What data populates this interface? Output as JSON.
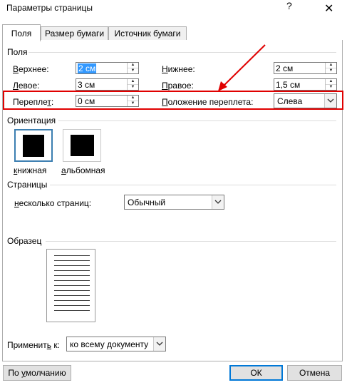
{
  "window": {
    "title": "Параметры страницы",
    "help_glyph": "?",
    "close_glyph": "✕"
  },
  "tabs": [
    {
      "label": "Поля",
      "active": true
    },
    {
      "label": "Размер бумаги",
      "active": false
    },
    {
      "label": "Источник бумаги",
      "active": false
    }
  ],
  "margins": {
    "group_label": "Поля",
    "top": {
      "label_u": "В",
      "label_rest": "ерхнее:",
      "value": "2 см"
    },
    "bottom": {
      "label_u": "Н",
      "label_rest": "ижнее:",
      "value": "2 см"
    },
    "left": {
      "label_u": "Л",
      "label_rest": "евое:",
      "value": "3 см"
    },
    "right": {
      "label_u": "П",
      "label_rest": "равое:",
      "value": "1,5 см"
    },
    "gutter": {
      "label_pre": "Перепле",
      "label_u": "т",
      "label_post": ":",
      "value": "0 см"
    },
    "gutter_pos": {
      "label_u": "П",
      "label_rest": "оложение переплета:",
      "value": "Слева"
    }
  },
  "orientation": {
    "group_label": "Ориентация",
    "portrait": {
      "label_u": "к",
      "label_rest": "нижная"
    },
    "landscape": {
      "label_u": "а",
      "label_rest": "льбомная"
    }
  },
  "pages": {
    "group_label": "Страницы",
    "multiple_label_u": "н",
    "multiple_label_rest": "есколько страниц:",
    "multiple_value": "Обычный"
  },
  "sample": {
    "group_label": "Образец"
  },
  "apply": {
    "label_pre": "Применит",
    "label_u": "ь",
    "label_post": " к:",
    "value": "ко всему документу"
  },
  "buttons": {
    "default_label_pre": "По ",
    "default_label_u": "у",
    "default_label_post": "молчанию",
    "ok": "ОК",
    "cancel": "Отмена"
  },
  "annotation": {
    "highlight_color": "#e00000"
  }
}
